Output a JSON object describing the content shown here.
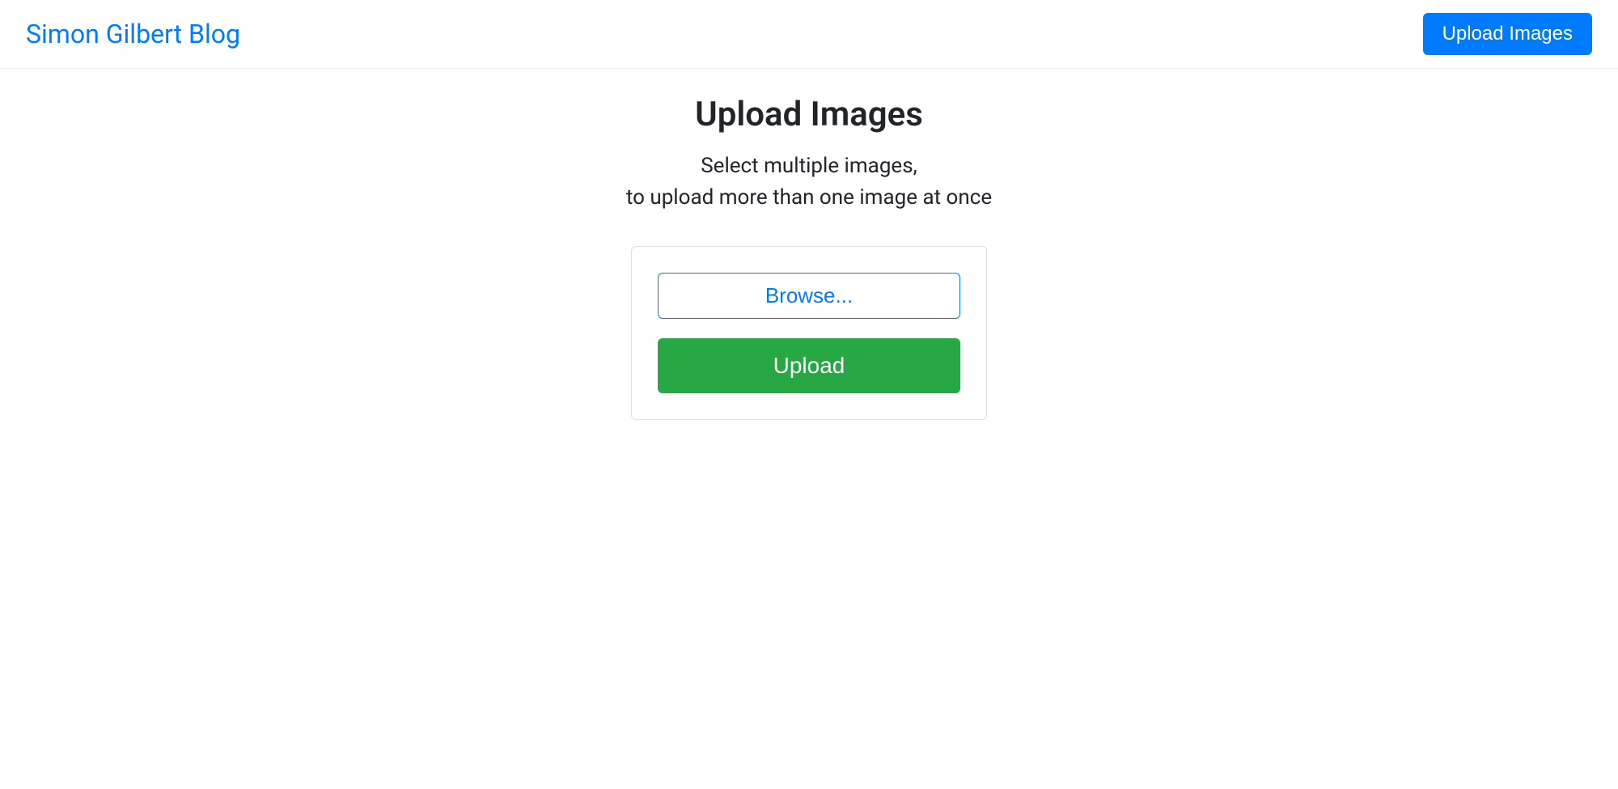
{
  "navbar": {
    "brand": "Simon Gilbert Blog",
    "upload_button": "Upload Images"
  },
  "main": {
    "title": "Upload Images",
    "subtitle_line1": "Select multiple images,",
    "subtitle_line2": "to upload more than one image at once",
    "browse_button": "Browse...",
    "upload_button": "Upload"
  }
}
